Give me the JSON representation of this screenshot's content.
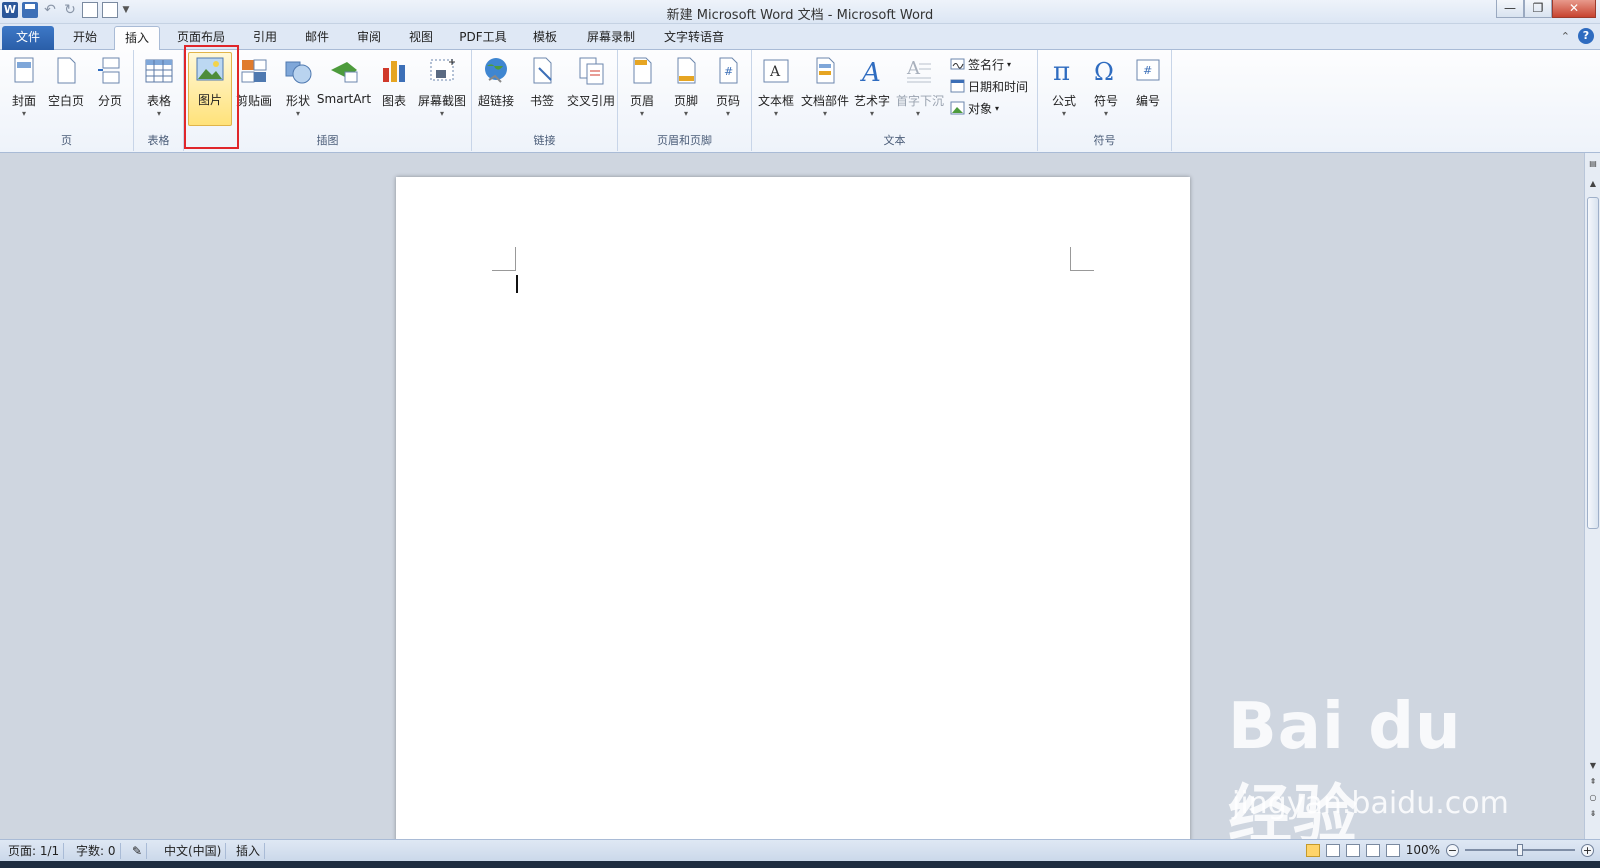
{
  "window": {
    "title": "新建 Microsoft Word 文档 - Microsoft Word",
    "qat_app_icon_letter": "W",
    "close_symbol": "✕",
    "restore_symbol": "❐",
    "minimize_symbol": "—"
  },
  "tabs": [
    {
      "label": "文件"
    },
    {
      "label": "开始"
    },
    {
      "label": "插入"
    },
    {
      "label": "页面布局"
    },
    {
      "label": "引用"
    },
    {
      "label": "邮件"
    },
    {
      "label": "审阅"
    },
    {
      "label": "视图"
    },
    {
      "label": "PDF工具"
    },
    {
      "label": "模板"
    },
    {
      "label": "屏幕录制"
    },
    {
      "label": "文字转语音"
    }
  ],
  "help_symbol": "?",
  "ribbon": {
    "groups": {
      "page": "页",
      "table": "表格",
      "illustrations": "插图",
      "links": "链接",
      "header_footer": "页眉和页脚",
      "text": "文本",
      "symbols": "符号"
    },
    "buttons": {
      "cover": "封面",
      "blank_page": "空白页",
      "page_break": "分页",
      "table": "表格",
      "picture": "图片",
      "clip_art": "剪贴画",
      "shapes": "形状",
      "smartart": "SmartArt",
      "chart": "图表",
      "screenshot": "屏幕截图",
      "hyperlink": "超链接",
      "bookmark": "书签",
      "cross_reference": "交叉引用",
      "header": "页眉",
      "footer": "页脚",
      "page_number": "页码",
      "text_box": "文本框",
      "quick_parts": "文档部件",
      "wordart": "艺术字",
      "drop_cap": "首字下沉",
      "signature_line": "签名行",
      "date_time": "日期和时间",
      "object": "对象",
      "equation": "公式",
      "symbol": "符号",
      "numbering": "编号"
    }
  },
  "status": {
    "page": "页面: 1/1",
    "words": "字数: 0",
    "language": "中文(中国)",
    "mode": "插入",
    "zoom": "100%",
    "zoom_minus": "−",
    "zoom_plus": "+"
  },
  "watermark": {
    "logo": "Bai du 经验",
    "url": "jingyan.baidu.com"
  },
  "colors": {
    "file_tab": "#2a5ea8",
    "highlight_box": "#e0262a",
    "selected_button": "#ffe27a"
  }
}
